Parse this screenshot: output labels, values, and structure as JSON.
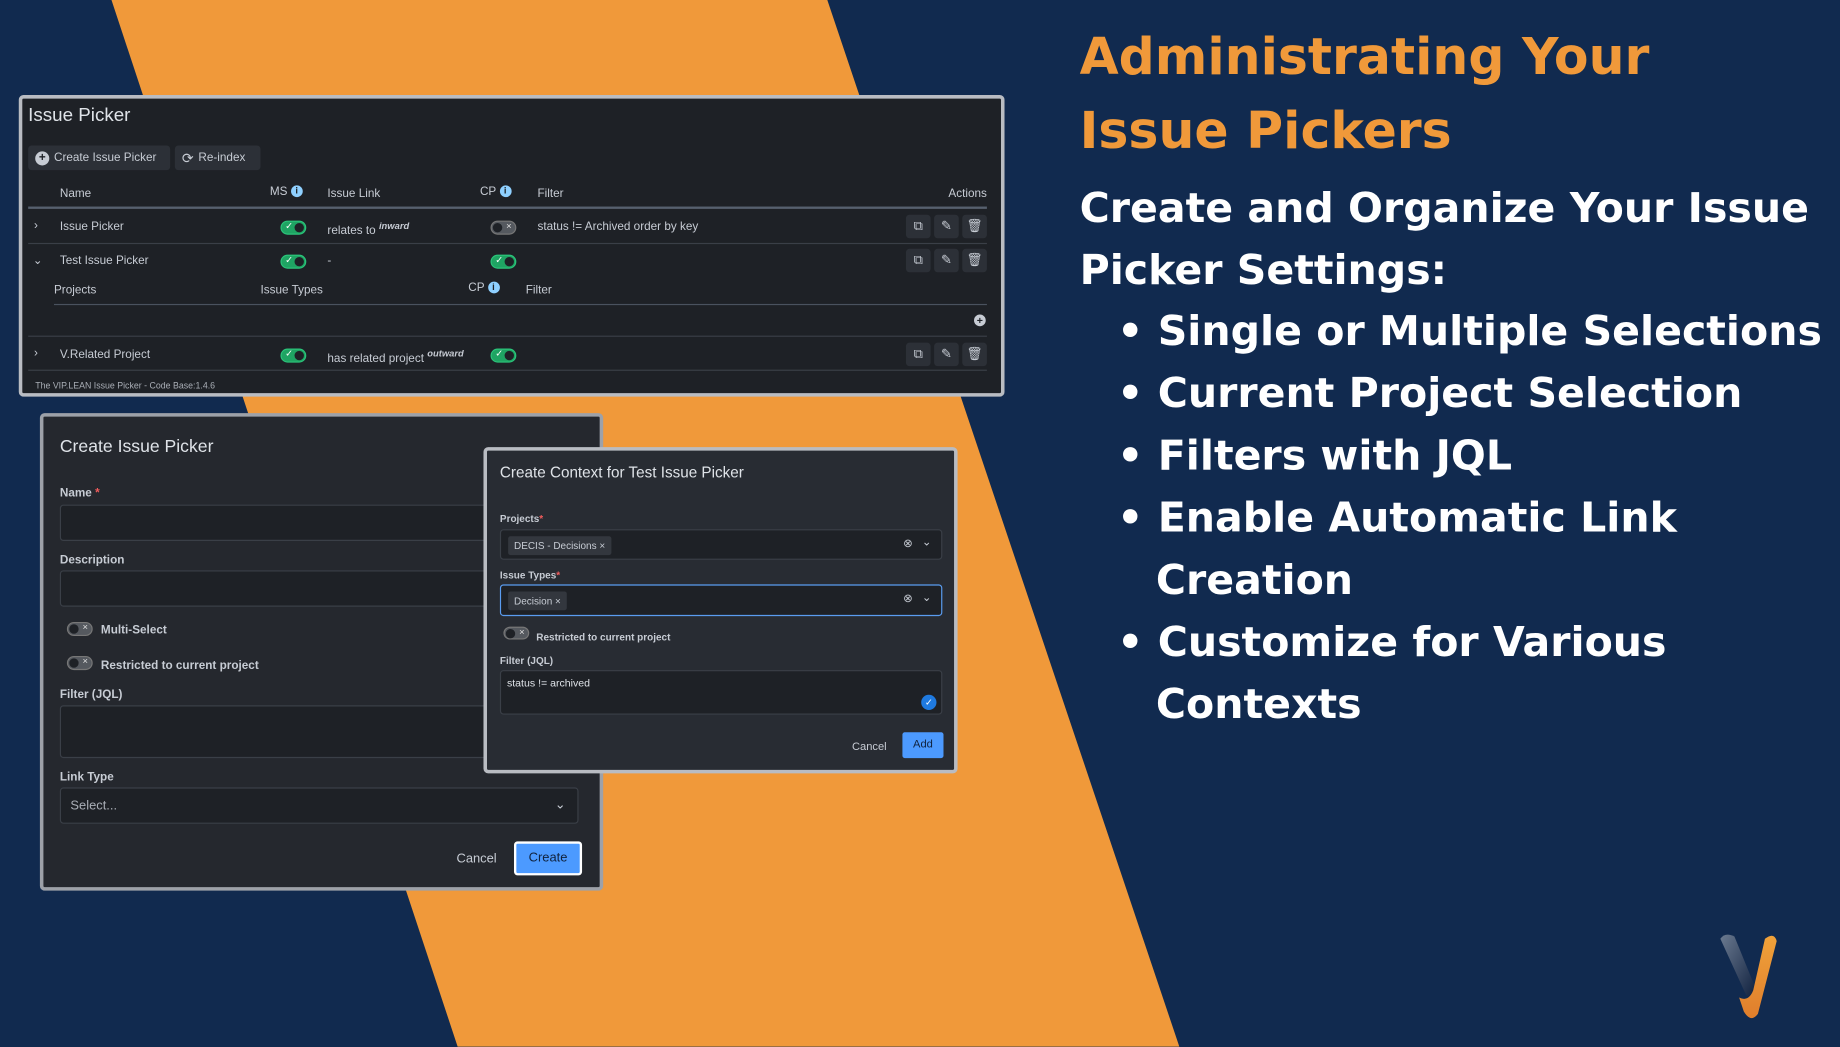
{
  "colors": {
    "background": "#112a4f",
    "accent": "#f0993a",
    "primary_button": "#4c9aff",
    "toggle_on": "#1fa463"
  },
  "issue_picker": {
    "title": "Issue Picker",
    "create_button": "Create Issue Picker",
    "reindex_button": "Re-index",
    "columns": {
      "name": "Name",
      "ms": "MS",
      "issue_link": "Issue Link",
      "cp": "CP",
      "filter": "Filter",
      "actions": "Actions"
    },
    "rows": [
      {
        "name": "Issue Picker",
        "ms": true,
        "link": "relates to",
        "direction": "inward",
        "cp": false,
        "filter": "status != Archived order by key"
      },
      {
        "name": "Test Issue Picker",
        "ms": true,
        "link": "-",
        "direction": "",
        "cp": true,
        "filter": ""
      },
      {
        "name": "V.Related Project",
        "ms": true,
        "link": "has related project",
        "direction": "outward",
        "cp": true,
        "filter": ""
      }
    ],
    "sub_columns": {
      "projects": "Projects",
      "issue_types": "Issue Types",
      "cp": "CP",
      "filter": "Filter"
    },
    "footer": "The VIP.LEAN Issue Picker - Code Base:1.4.6"
  },
  "create_dialog": {
    "title": "Create Issue Picker",
    "name_label": "Name",
    "description_label": "Description",
    "multi_select_label": "Multi-Select",
    "restricted_label": "Restricted to current project",
    "filter_label": "Filter (JQL)",
    "link_type_label": "Link Type",
    "link_type_placeholder": "Select...",
    "cancel": "Cancel",
    "create": "Create"
  },
  "context_dialog": {
    "title": "Create Context for Test Issue Picker",
    "projects_label": "Projects",
    "project_chip": "DECIS - Decisions",
    "issue_types_label": "Issue Types",
    "issue_type_chip": "Decision",
    "restricted_label": "Restricted to current project",
    "filter_label": "Filter (JQL)",
    "filter_value": "status != archived",
    "cancel": "Cancel",
    "add": "Add"
  },
  "marketing": {
    "title_line1": "Administrating Your",
    "title_line2": "Issue Pickers",
    "subtitle_line1": "Create and Organize Your Issue",
    "subtitle_line2": "Picker Settings:",
    "bullets": [
      "Single or Multiple Selections",
      "Current Project Selection",
      "Filters with JQL",
      "Enable Automatic Link",
      "Creation",
      "Customize for Various",
      "Contexts"
    ]
  }
}
